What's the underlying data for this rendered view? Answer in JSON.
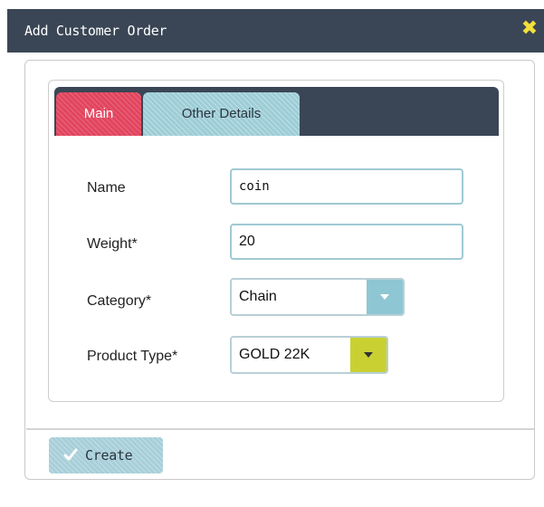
{
  "dialog": {
    "title": "Add Customer Order",
    "close_icon": "close-icon"
  },
  "tabs": [
    {
      "label": "Main",
      "active": true
    },
    {
      "label": "Other Details",
      "active": false
    }
  ],
  "form": {
    "name": {
      "label": "Name",
      "value": "coin"
    },
    "weight": {
      "label": "Weight*",
      "value": "20"
    },
    "category": {
      "label": "Category*",
      "value": "Chain"
    },
    "product_type": {
      "label": "Product Type*",
      "value": "GOLD 22K"
    }
  },
  "actions": {
    "create_label": "Create",
    "create_icon": "check-icon"
  },
  "colors": {
    "titlebar": "#3a4655",
    "tab_active": "#e2455f",
    "tab_inactive": "#9dcdd7",
    "category_button": "#8fc6d3",
    "product_button": "#c9d132",
    "close_icon": "#f2df3a"
  }
}
